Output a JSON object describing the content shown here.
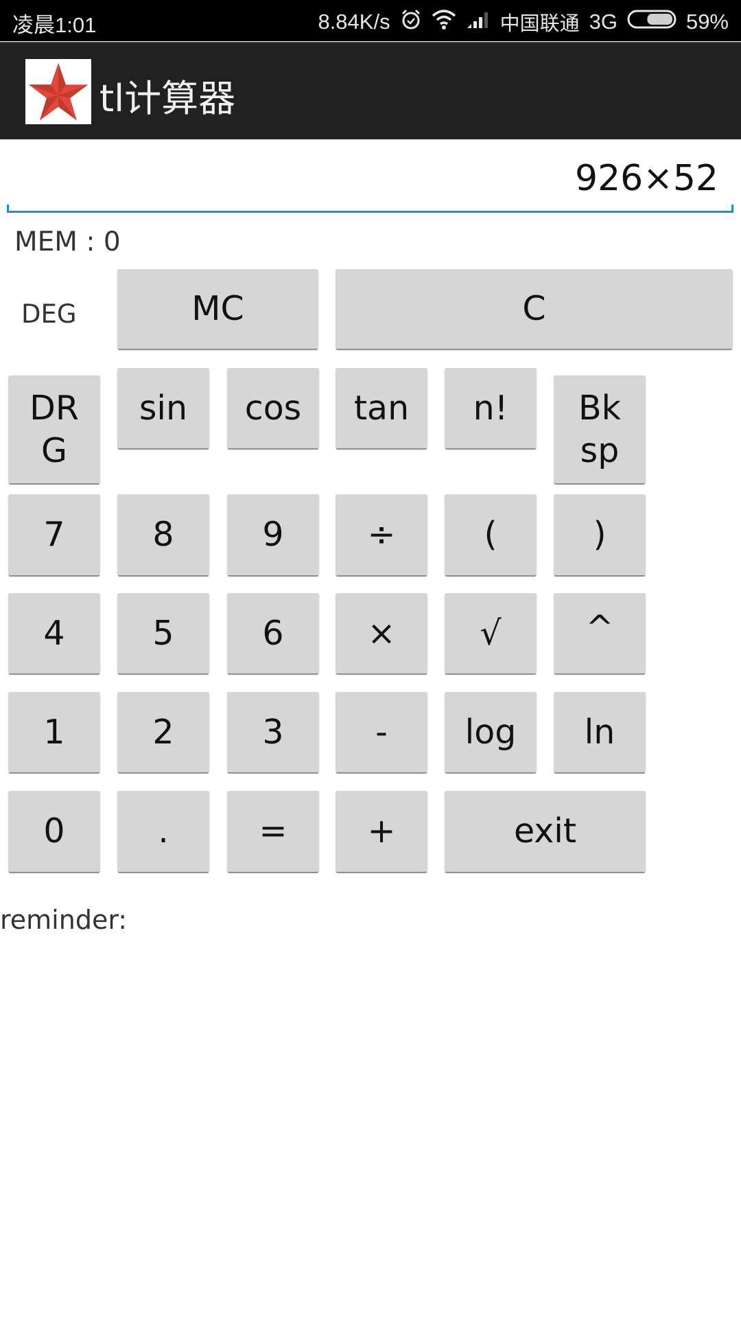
{
  "status_bar": {
    "time": "凌晨1:01",
    "network_speed": "8.84K/s",
    "carrier": "中国联通",
    "network_type": "3G",
    "battery_percent": "59%",
    "battery_level": 0.59,
    "icons": [
      "alarm-icon",
      "wifi-icon",
      "signal-icon",
      "battery-icon"
    ]
  },
  "app_bar": {
    "title": "tl计算器",
    "icon": "red-star-icon"
  },
  "display": {
    "value": "926×52"
  },
  "memory": {
    "label": "MEM :  0"
  },
  "angle_mode": "DEG",
  "buttons": {
    "mc": "MC",
    "c": "C",
    "drg": "DR\nG",
    "sin": "sin",
    "cos": "cos",
    "tan": "tan",
    "fact": "n!",
    "bksp": "Bk\nsp",
    "n7": "7",
    "n8": "8",
    "n9": "9",
    "div": "÷",
    "lparen": "(",
    "rparen": ")",
    "n4": "4",
    "n5": "5",
    "n6": "6",
    "mul": "×",
    "sqrt": "√",
    "pow": "^",
    "n1": "1",
    "n2": "2",
    "n3": "3",
    "sub": "-",
    "log": "log",
    "ln": "ln",
    "n0": "0",
    "dot": ".",
    "eq": "=",
    "add": "+",
    "exit": "exit"
  },
  "reminder": {
    "label": "reminder:"
  }
}
